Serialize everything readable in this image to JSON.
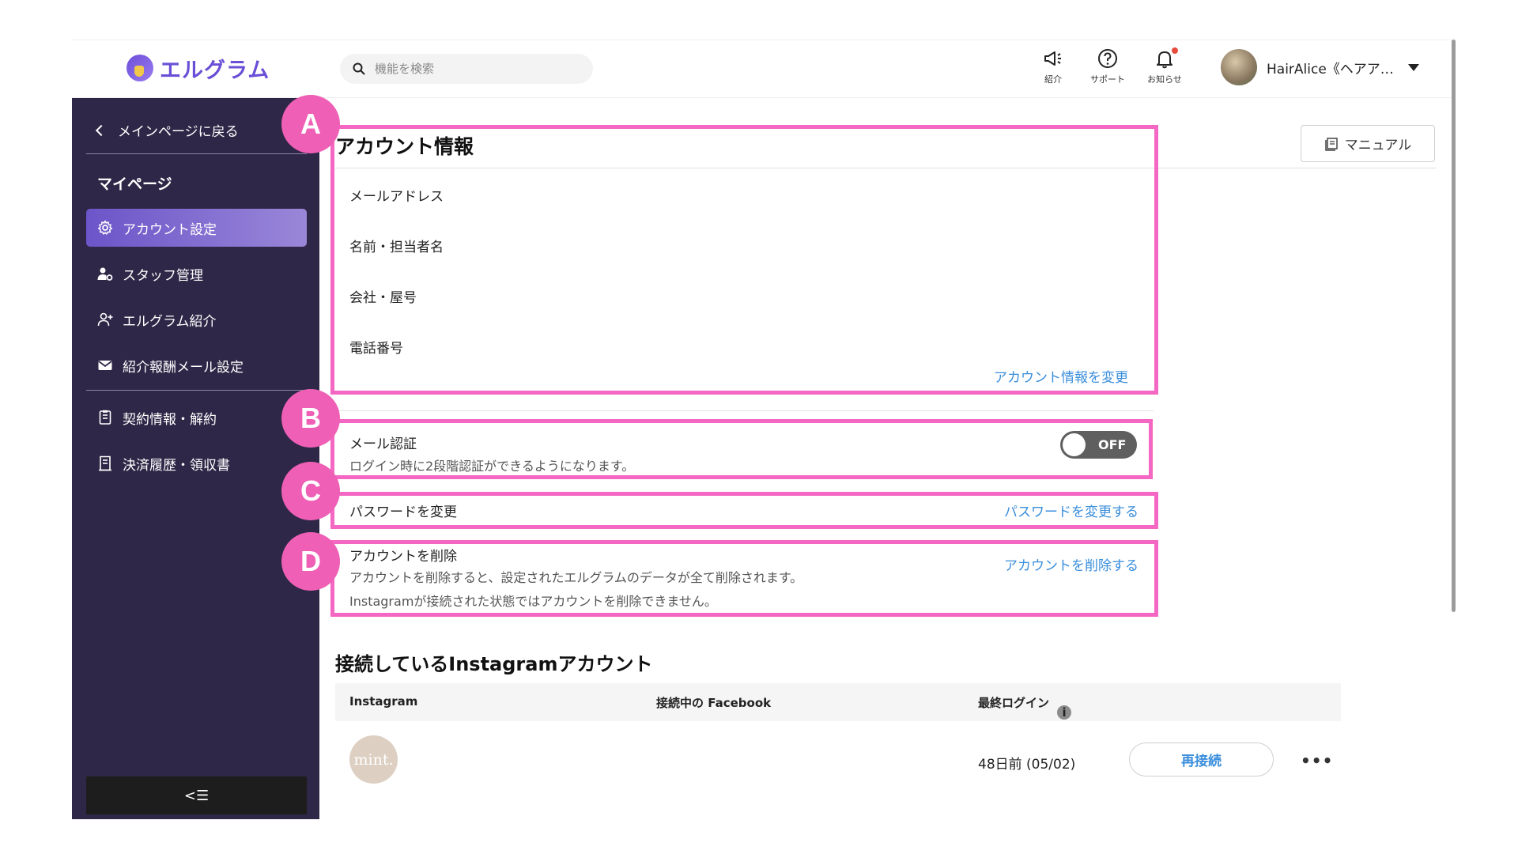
{
  "header": {
    "logo_text": "エルグラム",
    "search_placeholder": "機能を検索",
    "icons": [
      {
        "name": "megaphone-icon",
        "label": "紹介"
      },
      {
        "name": "help-icon",
        "label": "サポート"
      },
      {
        "name": "bell-icon",
        "label": "お知らせ"
      }
    ],
    "user_name": "HairAlice《ヘアア…",
    "notification_color": "#e74c3c"
  },
  "sidebar": {
    "back_label": "メインページに戻る",
    "section_title": "マイページ",
    "items": [
      {
        "label": "アカウント設定",
        "icon": "gear-icon",
        "active": true
      },
      {
        "label": "スタッフ管理",
        "icon": "staff-gear-icon"
      },
      {
        "label": "エルグラム紹介",
        "icon": "user-plus-icon"
      },
      {
        "label": "紹介報酬メール設定",
        "icon": "mail-icon"
      },
      {
        "label": "契約情報・解約",
        "icon": "document-icon"
      },
      {
        "label": "決済履歴・領収書",
        "icon": "receipt-icon"
      }
    ],
    "collapse_glyph": "<☰",
    "bg_color": "#2f2747",
    "accent": "#7a63d0"
  },
  "main": {
    "title": "アカウント情報",
    "manual_label": "マニュアル",
    "fields": [
      "メールアドレス",
      "名前・担当者名",
      "会社・屋号",
      "電話番号"
    ],
    "change_info_link": "アカウント情報を変更",
    "mail_auth": {
      "title": "メール認証",
      "description": "ログイン時に2段階認証ができるようになります。",
      "toggle_label": "OFF"
    },
    "password": {
      "title": "パスワードを変更",
      "link": "パスワードを変更する"
    },
    "delete": {
      "title": "アカウントを削除",
      "description1": "アカウントを削除すると、設定されたエルグラムのデータが全て削除されます。",
      "description2": "Instagramが接続された状態ではアカウントを削除できません。",
      "link": "アカウントを削除する"
    },
    "link_color": "#3a8edb"
  },
  "annotations": [
    "A",
    "B",
    "C",
    "D"
  ],
  "annotation_color": "#f467c2",
  "instagram": {
    "section_title": "接続しているInstagramアカウント",
    "columns": [
      "Instagram",
      "接続中の Facebook",
      "最終ログイン"
    ],
    "info_glyph": "i",
    "rows": [
      {
        "avatar_text": "mint.",
        "facebook": "",
        "last_login": "48日前 (05/02)",
        "action": "再接続",
        "more": "•••"
      }
    ]
  }
}
